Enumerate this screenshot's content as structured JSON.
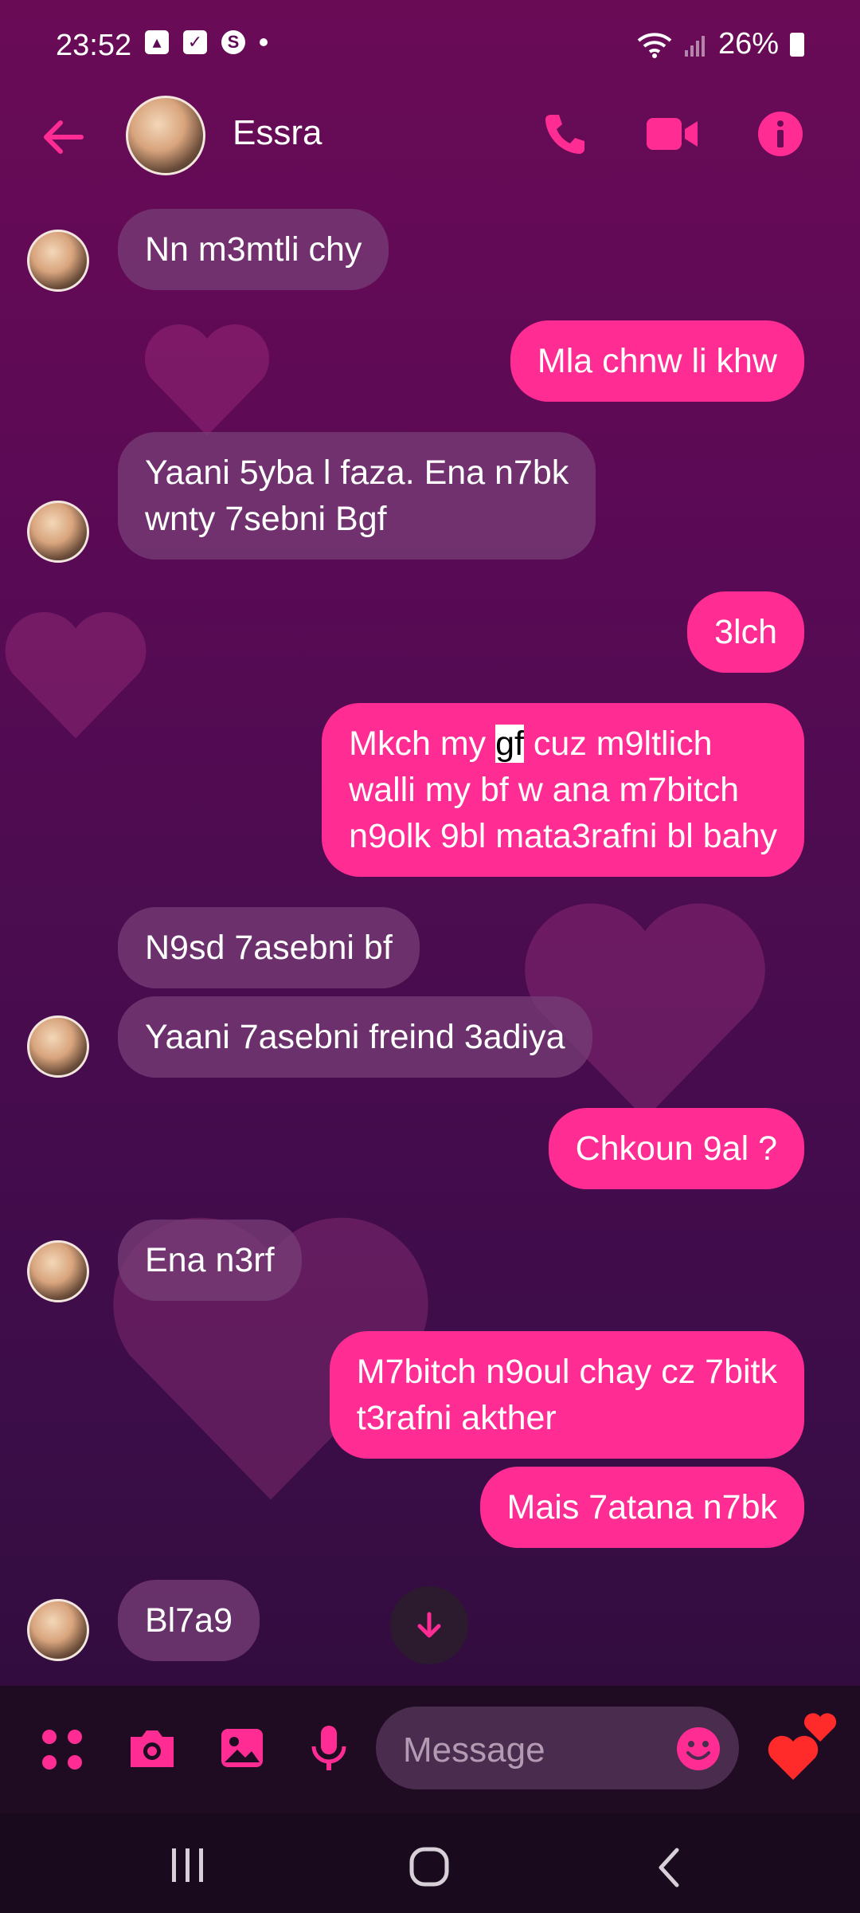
{
  "status_bar": {
    "time": "23:52",
    "battery": "26%"
  },
  "header": {
    "contact_name": "Essra"
  },
  "messages": [
    {
      "dir": "in",
      "text": "Nn m3mtli chy"
    },
    {
      "dir": "out",
      "text": "Mla chnw li khw"
    },
    {
      "dir": "in",
      "text": "Yaani 5yba l faza. Ena n7bk\nwnty 7sebni Bgf"
    },
    {
      "dir": "out",
      "text": "3lch"
    },
    {
      "dir": "out",
      "text_before": "Mkch my ",
      "highlight": "gf",
      "text_after": " cuz m9ltlich\nwalli my bf w ana m7bitch\nn9olk 9bl mata3rafni bl bahy"
    },
    {
      "dir": "in",
      "text": "N9sd 7asebni bf"
    },
    {
      "dir": "in",
      "text": "Yaani 7asebni freind 3adiya"
    },
    {
      "dir": "out",
      "text": "Chkoun 9al ?"
    },
    {
      "dir": "in",
      "text": "Ena n3rf"
    },
    {
      "dir": "out",
      "text": "M7bitch n9oul chay cz 7bitk\nt3rafni akther"
    },
    {
      "dir": "out",
      "text": "Mais 7atana n7bk"
    },
    {
      "dir": "in",
      "text": "Bl7a9"
    }
  ],
  "composer": {
    "placeholder": "Message"
  },
  "colors": {
    "accent": "#ff2c93",
    "incoming_bubble": "#763c76",
    "background": "#5c0a55"
  },
  "icons": [
    "back-arrow-icon",
    "phone-icon",
    "video-icon",
    "info-icon",
    "apps-grid-icon",
    "camera-icon",
    "gallery-icon",
    "mic-icon",
    "emoji-icon",
    "hearts-icon",
    "scroll-down-icon"
  ]
}
